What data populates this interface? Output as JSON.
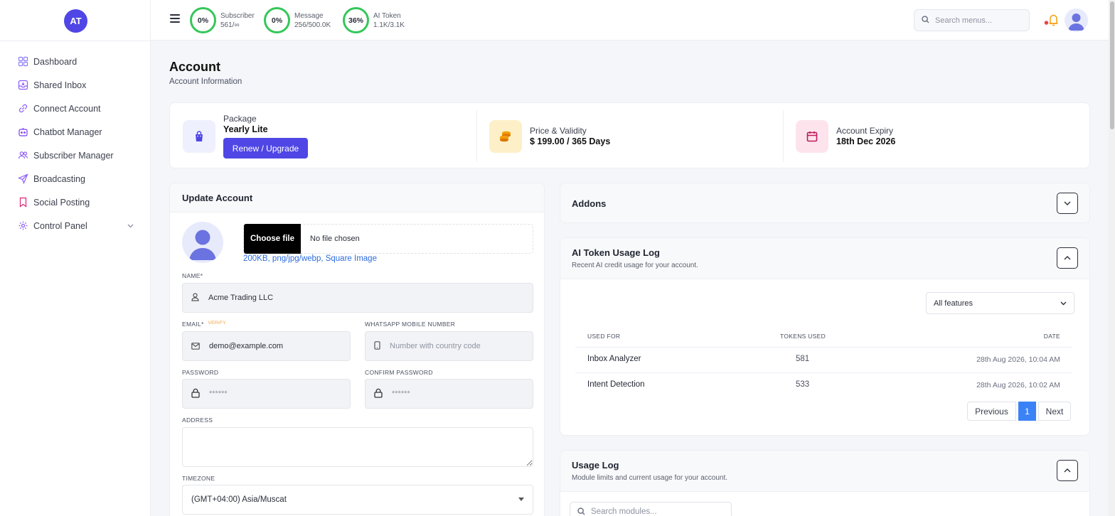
{
  "brand": {
    "initials": "AT"
  },
  "sidebar": {
    "items": [
      {
        "label": "Dashboard",
        "icon": "grid-icon"
      },
      {
        "label": "Shared Inbox",
        "icon": "inbox-icon"
      },
      {
        "label": "Connect Account",
        "icon": "link-icon"
      },
      {
        "label": "Chatbot Manager",
        "icon": "bot-icon"
      },
      {
        "label": "Subscriber Manager",
        "icon": "users-icon"
      },
      {
        "label": "Broadcasting",
        "icon": "send-icon"
      },
      {
        "label": "Social Posting",
        "icon": "bookmark-icon"
      },
      {
        "label": "Control Panel",
        "icon": "gear-icon"
      }
    ]
  },
  "topbar": {
    "stats": [
      {
        "percent": "0%",
        "label": "Subscriber",
        "value": "561/∞"
      },
      {
        "percent": "0%",
        "label": "Message",
        "value": "256/500.0K"
      },
      {
        "percent": "36%",
        "label": "AI Token",
        "value": "1.1K/3.1K"
      }
    ],
    "search_placeholder": "Search menus..."
  },
  "page": {
    "title": "Account",
    "subtitle": "Account Information"
  },
  "summary": {
    "package_label": "Package",
    "package_value": "Yearly Lite",
    "renew_label": "Renew / Upgrade",
    "price_label": "Price & Validity",
    "price_value": "$ 199.00 / 365 Days",
    "expiry_label": "Account Expiry",
    "expiry_value": "18th Dec 2026"
  },
  "update_account": {
    "title": "Update Account",
    "choose_file": "Choose file",
    "no_file": "No file chosen",
    "file_hint": "200KB, png/jpg/webp, Square Image",
    "name_label": "NAME*",
    "name_value": "Acme Trading LLC",
    "email_label": "EMAIL*",
    "verify_label": "VERIFY",
    "email_value": "demo@example.com",
    "whatsapp_label": "WHATSAPP MOBILE NUMBER",
    "whatsapp_placeholder": "Number with country code",
    "password_label": "PASSWORD",
    "password_placeholder": "******",
    "confirm_label": "CONFIRM PASSWORD",
    "confirm_placeholder": "******",
    "address_label": "ADDRESS",
    "timezone_label": "TIMEZONE",
    "timezone_value": "(GMT+04:00) Asia/Muscat"
  },
  "addons": {
    "title": "Addons"
  },
  "ai_log": {
    "title": "AI Token Usage Log",
    "subtitle": "Recent AI credit usage for your account.",
    "filter": "All features",
    "headers": {
      "used_for": "USED FOR",
      "tokens": "TOKENS USED",
      "date": "DATE"
    },
    "rows": [
      {
        "used_for": "Inbox Analyzer",
        "tokens": "581",
        "date": "28th Aug 2026, 10:04 AM"
      },
      {
        "used_for": "Intent Detection",
        "tokens": "533",
        "date": "28th Aug 2026, 10:02 AM"
      }
    ],
    "pager": {
      "prev": "Previous",
      "page": "1",
      "next": "Next"
    }
  },
  "usage_log": {
    "title": "Usage Log",
    "subtitle": "Module limits and current usage for your account.",
    "search_placeholder": "Search modules..."
  },
  "colors": {
    "accent": "#4f46e5",
    "ring": "#34c759",
    "link": "#2d6cdf",
    "page_active": "#3b82f6"
  }
}
